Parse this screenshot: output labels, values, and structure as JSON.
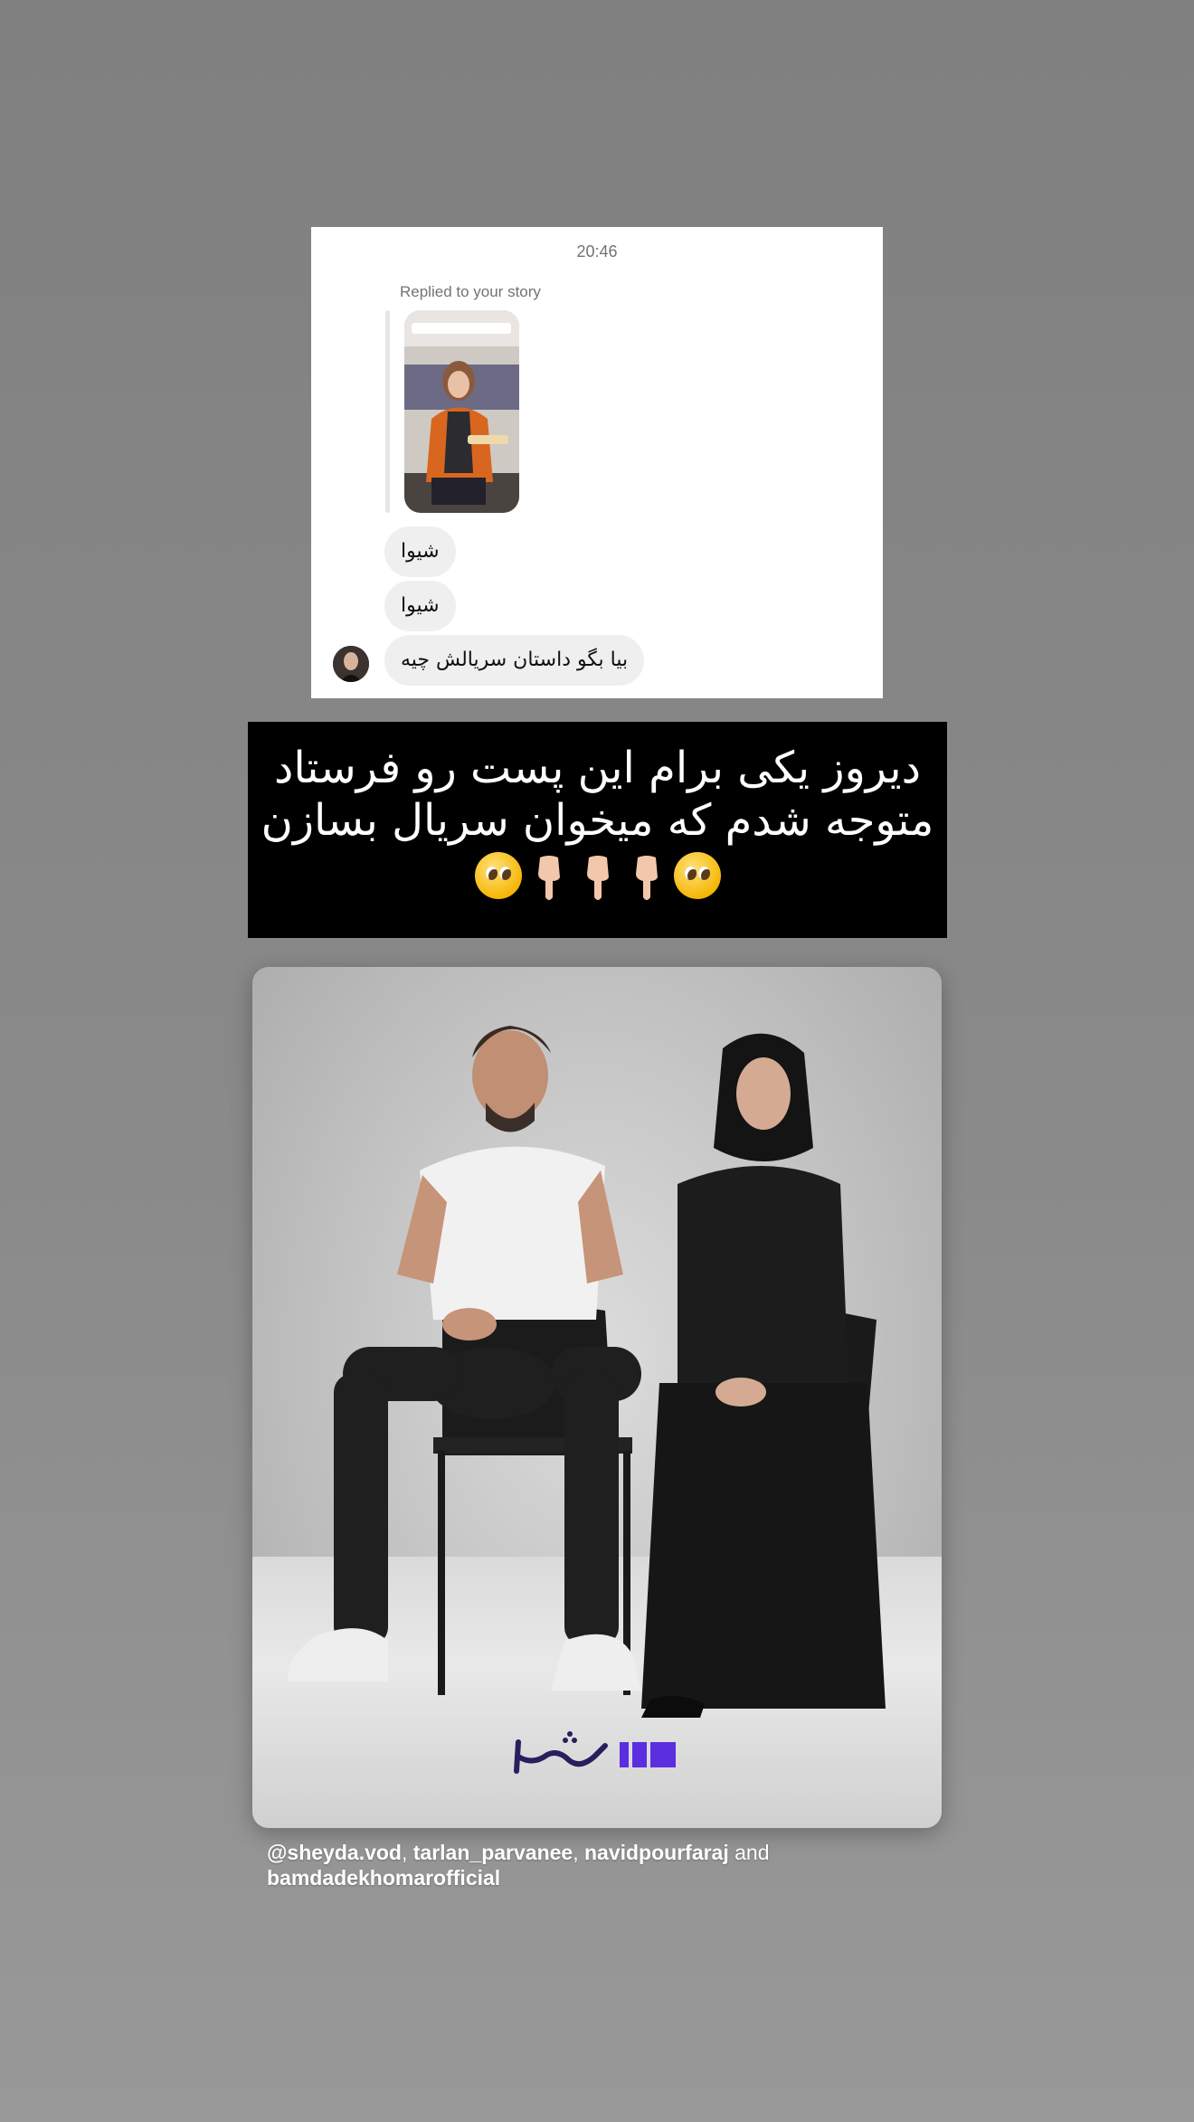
{
  "chat": {
    "time": "20:46",
    "replied_label": "Replied to your story",
    "messages": [
      "شیوا",
      "شیوا",
      "بیا بگو داستان سریالش چیه"
    ]
  },
  "caption": {
    "line1": "دیروز یکی برام این پست رو فرستاد",
    "line2": "متوجه شدم که میخوان سریال بسازن",
    "emojis": [
      "pleading-face",
      "pointing-down",
      "pointing-down",
      "pointing-down",
      "pleading-face"
    ]
  },
  "poster": {
    "logo_text": "شیدا",
    "brand_color": "#5b2ee0"
  },
  "mentions": {
    "handle1": "@sheyda.vod",
    "sep1": ", ",
    "handle2": "tarlan_parvanee",
    "sep2": ", ",
    "handle3": "navidpourfaraj",
    "conj": " and ",
    "handle4": "bamdadekhomarofficial"
  }
}
